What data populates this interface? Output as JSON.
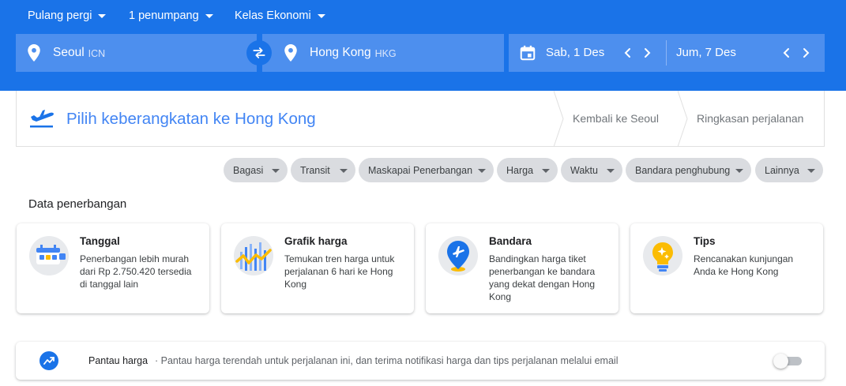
{
  "header": {
    "trip_type": "Pulang pergi",
    "passengers": "1 penumpang",
    "cabin_class": "Kelas Ekonomi",
    "origin": {
      "city": "Seoul",
      "code": "ICN"
    },
    "destination": {
      "city": "Hong Kong",
      "code": "HKG"
    },
    "departure_date": "Sab, 1 Des",
    "return_date": "Jum, 7 Des"
  },
  "steps": {
    "current": "Pilih keberangkatan ke Hong Kong",
    "next": "Kembali ke Seoul",
    "summary": "Ringkasan perjalanan"
  },
  "filters": [
    "Bagasi",
    "Transit",
    "Maskapai Penerbangan",
    "Harga",
    "Waktu",
    "Bandara penghubung",
    "Lainnya"
  ],
  "flight_data": {
    "title": "Data penerbangan",
    "cards": [
      {
        "title": "Tanggal",
        "desc": "Penerbangan lebih murah dari Rp 2.750.420 tersedia di tanggal lain"
      },
      {
        "title": "Grafik harga",
        "desc": "Temukan tren harga untuk perjalanan 6 hari ke Hong Kong"
      },
      {
        "title": "Bandara",
        "desc": "Bandingkan harga tiket penerbangan ke bandara yang dekat dengan Hong Kong"
      },
      {
        "title": "Tips",
        "desc": "Rencanakan kunjungan Anda ke Hong Kong"
      }
    ]
  },
  "price_tracking": {
    "title": "Pantau harga",
    "desc": "· Pantau harga terendah untuk perjalanan ini, dan terima notifikasi harga dan tips perjalanan melalui email",
    "enabled": false
  },
  "colors": {
    "brand": "#1a73e8",
    "field": "#4d8fee",
    "accent": "#4285f4"
  }
}
